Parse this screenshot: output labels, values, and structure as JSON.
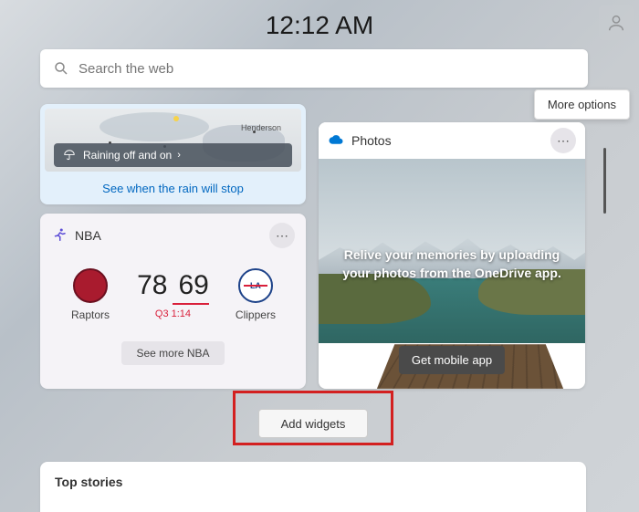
{
  "clock": "12:12 AM",
  "search": {
    "placeholder": "Search the web"
  },
  "more_options": "More options",
  "weather": {
    "map_label": "Henderson",
    "status": "Raining off and on",
    "link": "See when the rain will stop"
  },
  "nba": {
    "title": "NBA",
    "team_a": {
      "name": "Raptors",
      "score": "78"
    },
    "team_b": {
      "name": "Clippers",
      "score": "69"
    },
    "period": "Q3 1:14",
    "see_more": "See more NBA"
  },
  "photos": {
    "title": "Photos",
    "overlay": "Relive your memories by uploading your photos from the OneDrive app.",
    "cta": "Get mobile app"
  },
  "add_widgets": "Add widgets",
  "top_stories": {
    "title": "Top stories"
  }
}
